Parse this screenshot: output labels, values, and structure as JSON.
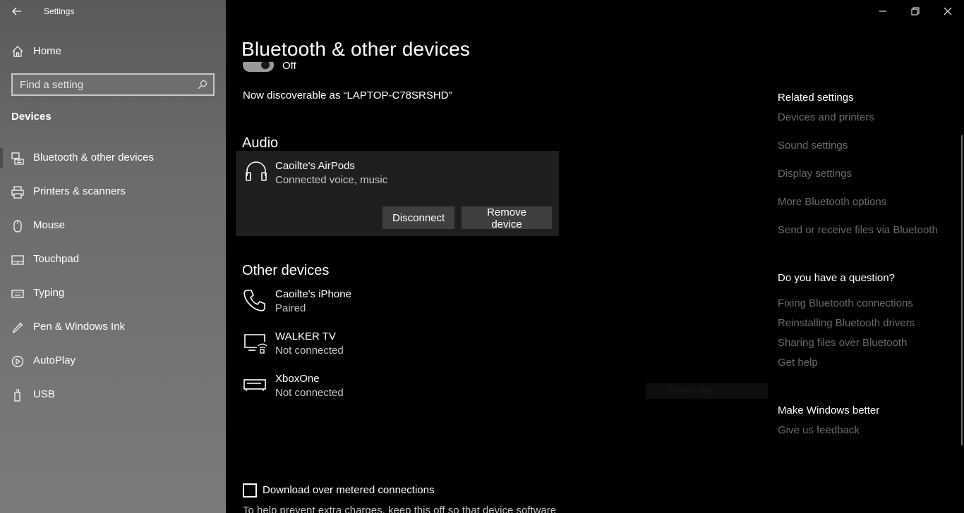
{
  "window": {
    "title": "Settings"
  },
  "sidebar": {
    "home_label": "Home",
    "search_placeholder": "Find a setting",
    "section": "Devices",
    "items": [
      {
        "label": "Bluetooth & other devices",
        "icon": "bluetooth-devices-icon",
        "selected": true
      },
      {
        "label": "Printers & scanners",
        "icon": "printer-icon"
      },
      {
        "label": "Mouse",
        "icon": "mouse-icon"
      },
      {
        "label": "Touchpad",
        "icon": "touchpad-icon"
      },
      {
        "label": "Typing",
        "icon": "keyboard-icon"
      },
      {
        "label": "Pen & Windows Ink",
        "icon": "pen-icon"
      },
      {
        "label": "AutoPlay",
        "icon": "autoplay-icon"
      },
      {
        "label": "USB",
        "icon": "usb-icon"
      }
    ]
  },
  "main": {
    "title": "Bluetooth & other devices",
    "bluetooth_state": "Off",
    "discoverable": "Now discoverable as “LAPTOP-C78SRSHD”",
    "audio": {
      "heading": "Audio",
      "device": {
        "name": "Caoilte's AirPods",
        "status": "Connected voice, music",
        "icon": "headphones-icon"
      },
      "disconnect_label": "Disconnect",
      "remove_label": "Remove device"
    },
    "other": {
      "heading": "Other devices",
      "devices": [
        {
          "name": "Caoilte's iPhone",
          "status": "Paired",
          "icon": "phone-icon"
        },
        {
          "name": "WALKER TV",
          "status": "Not connected",
          "icon": "tv-icon"
        },
        {
          "name": "XboxOne",
          "status": "Not connected",
          "icon": "console-icon"
        }
      ]
    },
    "metered": {
      "label": "Download over metered connections",
      "checked": false,
      "description": "To help prevent extra charges, keep this off so that device software"
    },
    "faint_text": "Rename app"
  },
  "related": {
    "heading": "Related settings",
    "links": [
      "Devices and printers",
      "Sound settings",
      "Display settings",
      "More Bluetooth options",
      "Send or receive files via Bluetooth"
    ],
    "question_heading": "Do you have a question?",
    "question_links": [
      "Fixing Bluetooth connections",
      "Reinstalling Bluetooth drivers",
      "Sharing files over Bluetooth",
      "Get help"
    ],
    "better_heading": "Make Windows better",
    "feedback": "Give us feedback"
  }
}
